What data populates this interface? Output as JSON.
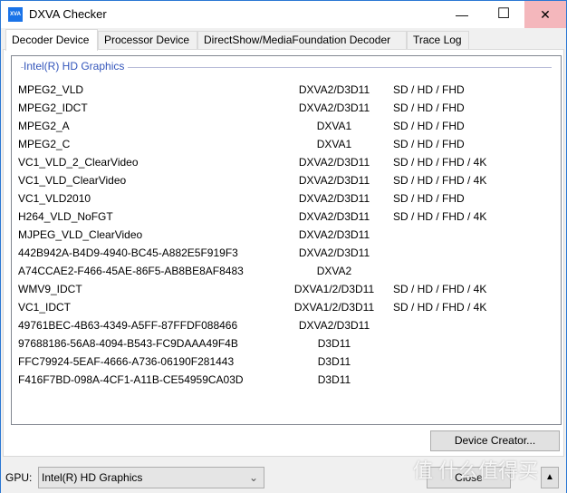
{
  "window": {
    "title": "DXVA Checker",
    "icon_text": "XVA",
    "minimize": "—",
    "maximize": "☐",
    "close": "✕"
  },
  "tabs": [
    "Decoder Device",
    "Processor Device",
    "DirectShow/MediaFoundation Decoder",
    "Trace Log"
  ],
  "group_title": "Intel(R) HD Graphics",
  "rows": [
    [
      "MPEG2_VLD",
      "DXVA2/D3D11",
      "SD / HD / FHD"
    ],
    [
      "MPEG2_IDCT",
      "DXVA2/D3D11",
      "SD / HD / FHD"
    ],
    [
      "MPEG2_A",
      "DXVA1",
      "SD / HD / FHD"
    ],
    [
      "MPEG2_C",
      "DXVA1",
      "SD / HD / FHD"
    ],
    [
      "VC1_VLD_2_ClearVideo",
      "DXVA2/D3D11",
      "SD / HD / FHD / 4K"
    ],
    [
      "VC1_VLD_ClearVideo",
      "DXVA2/D3D11",
      "SD / HD / FHD / 4K"
    ],
    [
      "VC1_VLD2010",
      "DXVA2/D3D11",
      "SD / HD / FHD"
    ],
    [
      "H264_VLD_NoFGT",
      "DXVA2/D3D11",
      "SD / HD / FHD / 4K"
    ],
    [
      "MJPEG_VLD_ClearVideo",
      "DXVA2/D3D11",
      ""
    ],
    [
      "442B942A-B4D9-4940-BC45-A882E5F919F3",
      "DXVA2/D3D11",
      ""
    ],
    [
      "A74CCAE2-F466-45AE-86F5-AB8BE8AF8483",
      "DXVA2",
      ""
    ],
    [
      "WMV9_IDCT",
      "DXVA1/2/D3D11",
      "SD / HD / FHD / 4K"
    ],
    [
      "VC1_IDCT",
      "DXVA1/2/D3D11",
      "SD / HD / FHD / 4K"
    ],
    [
      "49761BEC-4B63-4349-A5FF-87FFDF088466",
      "DXVA2/D3D11",
      ""
    ],
    [
      "97688186-56A8-4094-B543-FC9DAAA49F4B",
      "D3D11",
      ""
    ],
    [
      "FFC79924-5EAF-4666-A736-06190F281443",
      "D3D11",
      ""
    ],
    [
      "F416F7BD-098A-4CF1-A11B-CE54959CA03D",
      "D3D11",
      ""
    ]
  ],
  "device_creator": "Device Creator...",
  "gpu_label": "GPU:",
  "gpu_value": "Intel(R) HD Graphics",
  "close_button": "Close",
  "watermark": "值 什么值得买"
}
